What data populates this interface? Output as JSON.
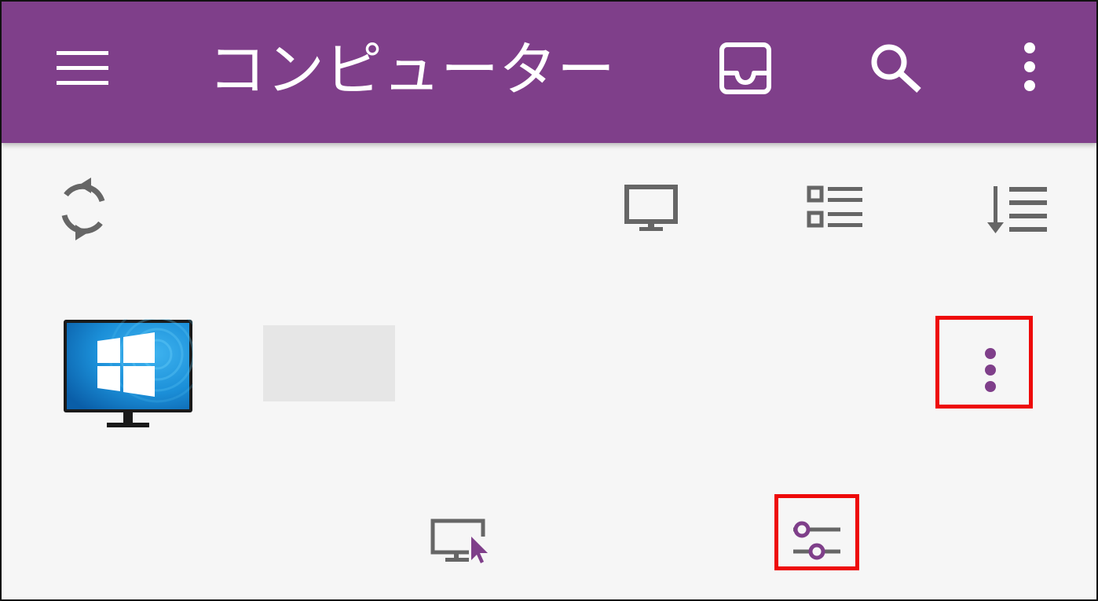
{
  "appbar": {
    "title": "コンピューター",
    "background_color": "#7f3f8a",
    "icons": {
      "menu": "menu-icon",
      "inbox": "inbox-icon",
      "search": "search-icon",
      "overflow": "more-vertical-icon"
    }
  },
  "toolbar": {
    "icons": {
      "refresh": "refresh-icon",
      "display": "monitor-icon",
      "view_mode": "list-view-icon",
      "sort": "sort-icon"
    },
    "icon_color": "#666666"
  },
  "computer_item": {
    "icon": "windows-computer-icon",
    "name": "",
    "more_menu": "more-vertical-icon",
    "actions": {
      "remote_control": "remote-control-icon",
      "settings": "settings-sliders-icon"
    },
    "accent_color": "#7f3f8a"
  },
  "annotations": {
    "highlight_color": "#ee0a0a"
  }
}
